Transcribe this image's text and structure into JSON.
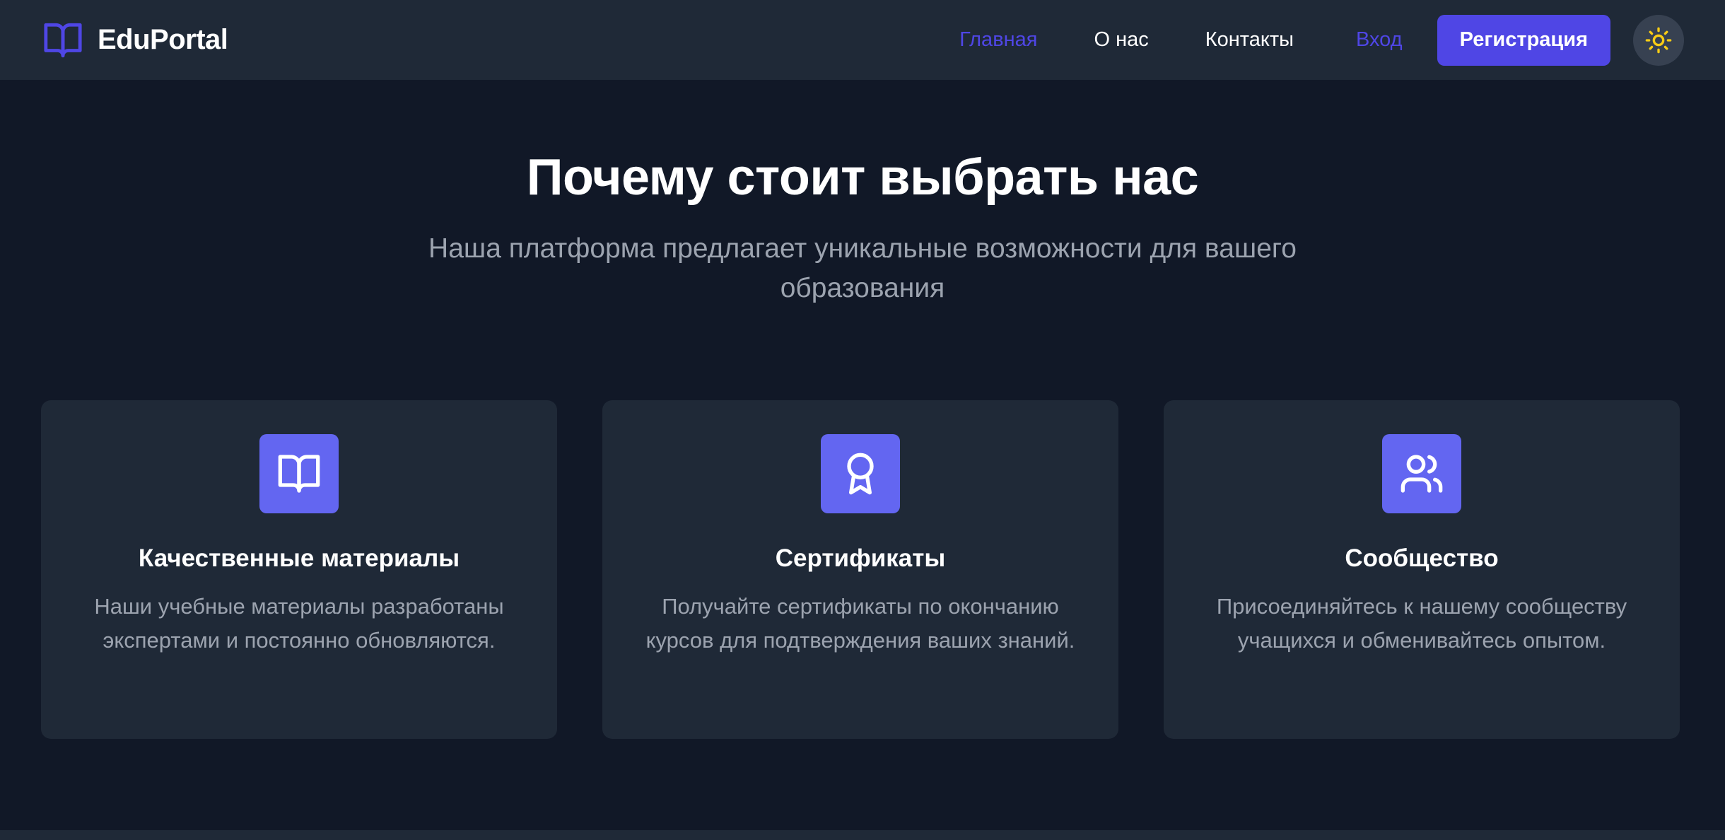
{
  "colors": {
    "background": "#111827",
    "surface": "#1f2937",
    "accent": "#4f46e5",
    "icon_tile": "#6366f1",
    "muted_text": "#9ca3af",
    "sun": "#facc15"
  },
  "header": {
    "brand": {
      "name": "EduPortal",
      "icon": "book-open-icon"
    },
    "nav": [
      {
        "label": "Главная",
        "active": true
      },
      {
        "label": "О нас",
        "active": false
      },
      {
        "label": "Контакты",
        "active": false
      }
    ],
    "login_label": "Вход",
    "register_label": "Регистрация",
    "theme_toggle_icon": "sun-icon"
  },
  "features": {
    "title": "Почему стоит выбрать нас",
    "subtitle": "Наша платформа предлагает уникальные возможности для вашего образования",
    "cards": [
      {
        "icon": "book-open-icon",
        "title": "Качественные материалы",
        "text": "Наши учебные материалы разработаны экспертами и постоянно обновляются."
      },
      {
        "icon": "award-icon",
        "title": "Сертификаты",
        "text": "Получайте сертификаты по окончанию курсов для подтверждения ваших знаний."
      },
      {
        "icon": "users-icon",
        "title": "Сообщество",
        "text": "Присоединяйтесь к нашему сообществу учащихся и обменивайтесь опытом."
      }
    ]
  }
}
